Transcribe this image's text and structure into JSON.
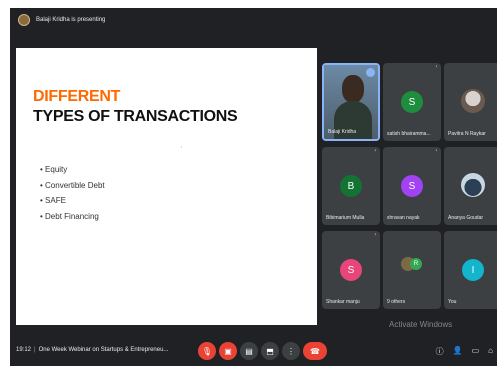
{
  "presenter": {
    "text": "Balaji Kridha is presenting"
  },
  "slide": {
    "title_line1": "DIFFERENT",
    "title_line2": "TYPES OF TRANSACTIONS",
    "bullets": [
      "Equity",
      "Convertible Debt",
      "SAFE",
      "Debt Financing"
    ]
  },
  "participants": [
    {
      "name": "Balaji Kridha",
      "type": "video",
      "speaking": true
    },
    {
      "name": "satish bhairamma...",
      "initial": "S",
      "color": "#1e8e3e"
    },
    {
      "name": "Pavitra N Raykar",
      "type": "photo"
    },
    {
      "name": "Bibimarium Mulla",
      "initial": "B",
      "color": "#137333"
    },
    {
      "name": "shravan nayak",
      "initial": "S",
      "color": "#a142f4"
    },
    {
      "name": "Ananya Goudar",
      "type": "photo2"
    },
    {
      "name": "Shankar manju",
      "initial": "S",
      "color": "#e8457a"
    },
    {
      "name": "9 others",
      "type": "cluster",
      "initial": "R"
    },
    {
      "name": "You",
      "initial": "I",
      "color": "#12b5cb"
    }
  ],
  "bottom": {
    "time": "19:12",
    "meeting_title": "One Week Webinar on Startups & Entrepreneu...",
    "watermark": "Activate Windows"
  },
  "icons": {
    "mic_off": "mic-off-icon",
    "cam_off": "camera-off-icon",
    "captions": "captions-icon",
    "present": "present-icon",
    "more": "more-icon",
    "end_call": "end-call-icon"
  }
}
